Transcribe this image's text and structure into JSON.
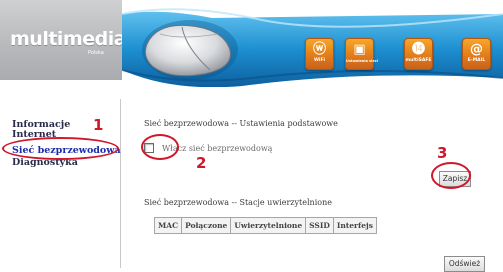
{
  "header": {
    "logo": "multimedia",
    "logo_sub": "Polska",
    "icons": [
      {
        "name": "wifi-icon",
        "caption": "WiFi",
        "glyph": "ⓦ"
      },
      {
        "name": "network-icon",
        "caption": "Ustawienia sieci",
        "glyph": "▣"
      },
      {
        "name": "multisafe-icon",
        "caption": "multiSAFE",
        "glyph": "⓮"
      },
      {
        "name": "email-icon",
        "caption": "E-MAIL",
        "glyph": "@"
      }
    ],
    "colors": {
      "icon_orange": "#e8841f",
      "banner_blue": "#1d8fd0"
    }
  },
  "sidebar": {
    "items": [
      {
        "label": "Informacje"
      },
      {
        "label": "Internet"
      },
      {
        "label": "Sieć bezprzewodowa"
      },
      {
        "label": "Diagnostyka"
      }
    ]
  },
  "main": {
    "basic_title": "Sieć bezprzewodowa -- Ustawienia podstawowe",
    "enable_wireless": {
      "label": "Włącz sieć bezprzewodową",
      "checked": false
    },
    "save_label": "Zapisz",
    "stations_title": "Sieć bezprzewodowa -- Stacje uwierzytelnione",
    "table_headers": [
      "MAC",
      "Połączone",
      "Uwierzytelnione",
      "SSID",
      "Interfejs"
    ],
    "refresh_label": "Odśwież"
  },
  "annotations": {
    "n1": "1",
    "n2": "2",
    "n3": "3",
    "color": "#d0182a"
  }
}
